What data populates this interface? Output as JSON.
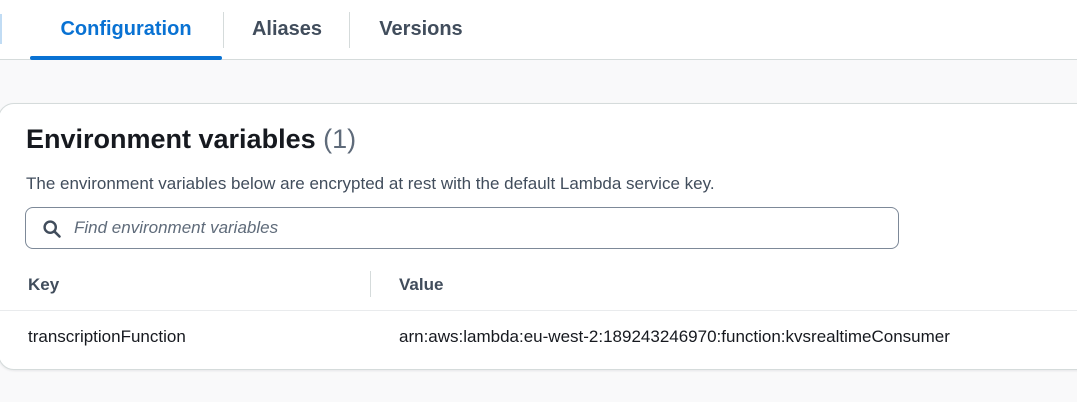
{
  "tabs": [
    {
      "label": "Configuration",
      "active": true
    },
    {
      "label": "Aliases",
      "active": false
    },
    {
      "label": "Versions",
      "active": false
    }
  ],
  "env": {
    "title": "Environment variables",
    "count": "(1)",
    "description": "The environment variables below are encrypted at rest with the default Lambda service key.",
    "search": {
      "placeholder": "Find environment variables",
      "value": "",
      "icon": "search-icon"
    },
    "columns": [
      "Key",
      "Value"
    ],
    "rows": [
      {
        "key": "transcriptionFunction",
        "value": "arn:aws:lambda:eu-west-2:189243246970:function:kvsrealtimeConsumer"
      }
    ]
  },
  "colors": {
    "accent": "#0972d3",
    "text": "#16191f",
    "muted": "#5f6b7a"
  }
}
